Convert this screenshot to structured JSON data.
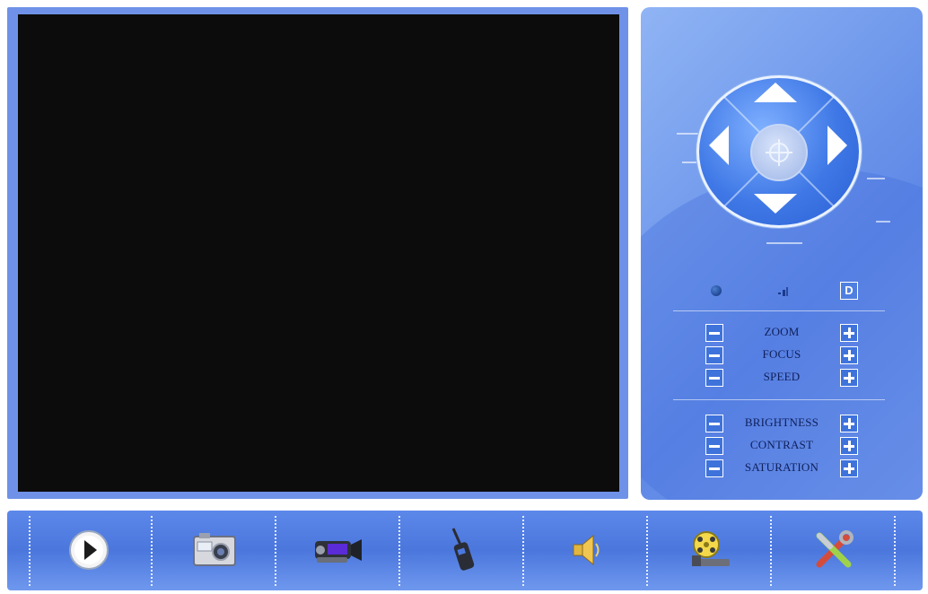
{
  "video": {
    "state": "no signal"
  },
  "ptz": {
    "up": "up-arrow-icon",
    "down": "down-arrow-icon",
    "left": "left-arrow-icon",
    "right": "right-arrow-icon",
    "center": "crosshair-icon"
  },
  "status": {
    "d_label": "D"
  },
  "camera_controls": [
    {
      "label": "ZOOM"
    },
    {
      "label": "FOCUS"
    },
    {
      "label": "SPEED"
    }
  ],
  "image_controls": [
    {
      "label": "BRIGHTNESS"
    },
    {
      "label": "CONTRAST"
    },
    {
      "label": "SATURATION"
    }
  ],
  "toolbar": {
    "buttons": [
      {
        "icon": "play-icon"
      },
      {
        "icon": "snapshot-camera-icon"
      },
      {
        "icon": "video-record-icon"
      },
      {
        "icon": "talk-microphone-icon"
      },
      {
        "icon": "speaker-icon"
      },
      {
        "icon": "playback-film-icon"
      },
      {
        "icon": "settings-tools-icon"
      }
    ]
  },
  "colors": {
    "panel_blue": "#6a94ea",
    "screen_black": "#0c0c0c",
    "toolbar_blue": "#4b77dd"
  }
}
